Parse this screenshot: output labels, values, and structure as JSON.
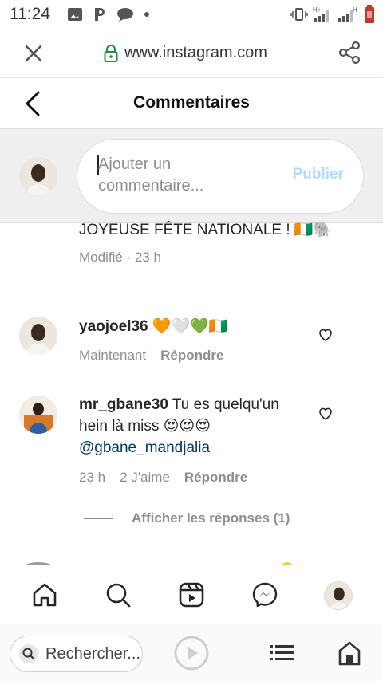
{
  "status_bar": {
    "time": "11:24",
    "icons": [
      "image-icon",
      "p-app-icon",
      "chat-bubble-icon",
      "dot-icon",
      "vibrate-icon",
      "signal-hplus-icon",
      "signal-h-icon",
      "battery-icon"
    ]
  },
  "browser": {
    "url": "www.instagram.com",
    "search_label": "Rechercher..."
  },
  "header": {
    "title": "Commentaires"
  },
  "composer": {
    "placeholder": "Ajouter un commentaire...",
    "publish_label": "Publier"
  },
  "caption": {
    "text": "JOYEUSE FÊTE NATIONALE ! 🇨🇮🐘",
    "edited": "Modifié",
    "time": "23 h"
  },
  "comments": [
    {
      "username": "yaojoel36",
      "text": "🧡🤍💚🇨🇮",
      "time": "Maintenant",
      "reply_label": "Répondre"
    },
    {
      "username": "mr_gbane30",
      "text": "Tu es quelqu'un hein là miss 😍😍😍",
      "mention": "@gbane_mandjalia",
      "time": "23 h",
      "likes": "2 J'aime",
      "reply_label": "Répondre",
      "view_replies": "Afficher les réponses (1)"
    }
  ],
  "colors": {
    "publish": "#b3dbff",
    "mention": "#00376b",
    "muted": "#8e8e8e",
    "composer_bg": "#efefef"
  }
}
